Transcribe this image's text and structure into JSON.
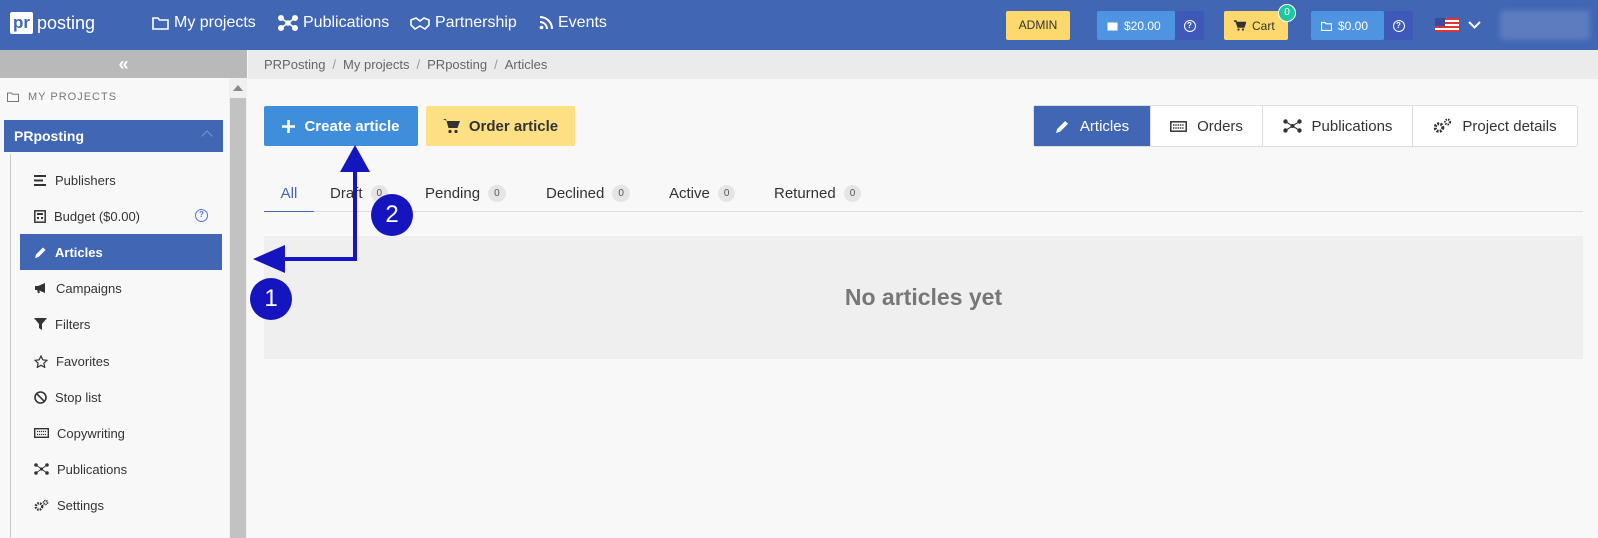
{
  "logo": {
    "box": "pr",
    "text": "posting"
  },
  "nav": [
    {
      "label": "My projects",
      "icon": "folder-icon"
    },
    {
      "label": "Publications",
      "icon": "network-icon"
    },
    {
      "label": "Partnership",
      "icon": "handshake-icon"
    },
    {
      "label": "Events",
      "icon": "rss-icon"
    }
  ],
  "header": {
    "admin_label": "ADMIN",
    "balance": "$20.00",
    "cart_label": "Cart",
    "cart_count": "0",
    "project_balance": "$0.00"
  },
  "sidebar": {
    "collapse_label": "«",
    "section_title": "MY PROJECTS",
    "project_name": "PRposting",
    "items": [
      {
        "label": "Publishers",
        "icon": "list-icon"
      },
      {
        "label": "Budget ($0.00)",
        "icon": "calculator-icon"
      },
      {
        "label": "Articles",
        "icon": "pencil-icon"
      },
      {
        "label": "Campaigns",
        "icon": "megaphone-icon"
      },
      {
        "label": "Filters",
        "icon": "filter-icon"
      },
      {
        "label": "Favorites",
        "icon": "star-icon"
      },
      {
        "label": "Stop list",
        "icon": "ban-icon"
      },
      {
        "label": "Copywriting",
        "icon": "keyboard-icon"
      },
      {
        "label": "Publications",
        "icon": "network-icon"
      },
      {
        "label": "Settings",
        "icon": "gears-icon"
      }
    ]
  },
  "breadcrumb": [
    "PRPosting",
    "My projects",
    "PRposting",
    "Articles"
  ],
  "actions": {
    "create": "Create article",
    "order": "Order article"
  },
  "view_tabs": [
    {
      "label": "Articles",
      "icon": "pencil-icon"
    },
    {
      "label": "Orders",
      "icon": "keyboard-icon"
    },
    {
      "label": "Publications",
      "icon": "network-icon"
    },
    {
      "label": "Project details",
      "icon": "gears-icon"
    }
  ],
  "status_tabs": [
    {
      "label": "All",
      "count": ""
    },
    {
      "label": "Draft",
      "count": "0"
    },
    {
      "label": "Pending",
      "count": "0"
    },
    {
      "label": "Declined",
      "count": "0"
    },
    {
      "label": "Active",
      "count": "0"
    },
    {
      "label": "Returned",
      "count": "0"
    }
  ],
  "empty_message": "No articles yet",
  "annotations": {
    "step1": "1",
    "step2": "2"
  },
  "colors": {
    "brand": "#4166b3",
    "accent": "#3f8edb",
    "yellow": "#fde084",
    "annotation": "#1515c0"
  }
}
